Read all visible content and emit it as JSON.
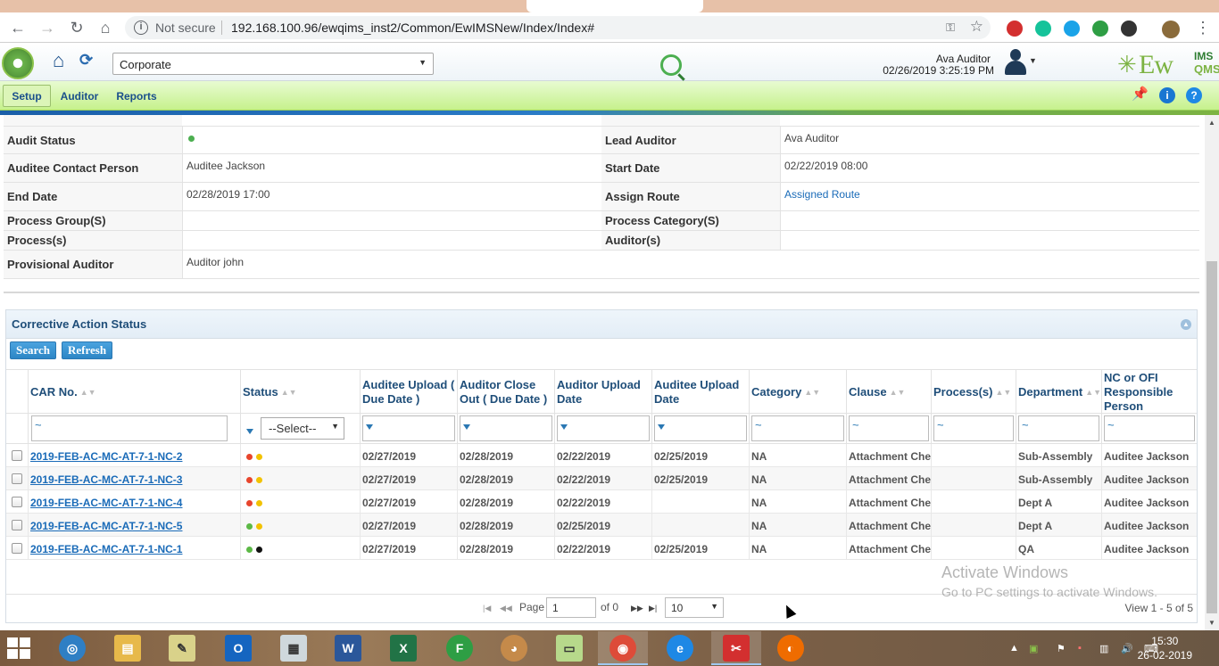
{
  "browser": {
    "security_label": "Not secure",
    "url": "192.168.100.96/ewqims_inst2/Common/EwIMSNew/Index/Index#"
  },
  "header": {
    "org_select_value": "Corporate",
    "user_name": "Ava Auditor",
    "user_datetime": "02/26/2019 3:25:19 PM",
    "brand_ew": "Ew",
    "brand_ims": "IMS",
    "brand_qms": "QMS"
  },
  "menu": {
    "items": [
      {
        "label": "Setup"
      },
      {
        "label": "Auditor"
      },
      {
        "label": "Reports"
      }
    ]
  },
  "details": {
    "audit_status": {
      "label": "Audit Status",
      "value": ""
    },
    "lead_auditor": {
      "label": "Lead Auditor",
      "value": "Ava Auditor"
    },
    "auditee_contact": {
      "label": "Auditee Contact Person",
      "value": "Auditee Jackson"
    },
    "start_date": {
      "label": "Start Date",
      "value": "02/22/2019 08:00"
    },
    "end_date": {
      "label": "End Date",
      "value": "02/28/2019 17:00"
    },
    "assign_route": {
      "label": "Assign Route",
      "value": "Assigned Route"
    },
    "process_group": {
      "label": "Process Group(S)",
      "value": ""
    },
    "process_category": {
      "label": "Process Category(S)",
      "value": ""
    },
    "processes": {
      "label": "Process(s)",
      "value": ""
    },
    "auditors": {
      "label": "Auditor(s)",
      "value": ""
    },
    "provisional_auditor": {
      "label": "Provisional Auditor",
      "value": "Auditor john"
    }
  },
  "car_panel": {
    "title": "Corrective Action Status",
    "search_label": "Search",
    "refresh_label": "Refresh",
    "columns": [
      {
        "label": "CAR No."
      },
      {
        "label": "Status"
      },
      {
        "label": "Auditee Upload ( Due Date )"
      },
      {
        "label": "Auditor Close Out ( Due Date )"
      },
      {
        "label": "Auditor Upload Date"
      },
      {
        "label": "Auditee Upload Date"
      },
      {
        "label": "Category"
      },
      {
        "label": "Clause"
      },
      {
        "label": "Process(s)"
      },
      {
        "label": "Department"
      },
      {
        "label": "NC or OFI Responsible Person"
      }
    ],
    "filter_placeholder": "~",
    "status_filter_value": "--Select--",
    "rows": [
      {
        "car_no": "2019-FEB-AC-MC-AT-7-1-NC-2",
        "dot1": "#e8452c",
        "dot2": "#f2c200",
        "auditee_due": "02/27/2019",
        "auditor_due": "02/28/2019",
        "auditor_upload": "02/22/2019",
        "auditee_upload": "02/25/2019",
        "category": "NA",
        "clause": "Attachment Chec",
        "process": "",
        "department": "Sub-Assembly",
        "responsible": "Auditee Jackson"
      },
      {
        "car_no": "2019-FEB-AC-MC-AT-7-1-NC-3",
        "dot1": "#e8452c",
        "dot2": "#f2c200",
        "auditee_due": "02/27/2019",
        "auditor_due": "02/28/2019",
        "auditor_upload": "02/22/2019",
        "auditee_upload": "02/25/2019",
        "category": "NA",
        "clause": "Attachment Chec",
        "process": "",
        "department": "Sub-Assembly",
        "responsible": "Auditee Jackson"
      },
      {
        "car_no": "2019-FEB-AC-MC-AT-7-1-NC-4",
        "dot1": "#e8452c",
        "dot2": "#f2c200",
        "auditee_due": "02/27/2019",
        "auditor_due": "02/28/2019",
        "auditor_upload": "02/22/2019",
        "auditee_upload": "",
        "category": "NA",
        "clause": "Attachment Chec",
        "process": "",
        "department": "Dept A",
        "responsible": "Auditee Jackson"
      },
      {
        "car_no": "2019-FEB-AC-MC-AT-7-1-NC-5",
        "dot1": "#5cb946",
        "dot2": "#f2c200",
        "auditee_due": "02/27/2019",
        "auditor_due": "02/28/2019",
        "auditor_upload": "02/25/2019",
        "auditee_upload": "",
        "category": "NA",
        "clause": "Attachment Chec",
        "process": "",
        "department": "Dept A",
        "responsible": "Auditee Jackson"
      },
      {
        "car_no": "2019-FEB-AC-MC-AT-7-1-NC-1",
        "dot1": "#5cb946",
        "dot2": "#111111",
        "auditee_due": "02/27/2019",
        "auditor_due": "02/28/2019",
        "auditor_upload": "02/22/2019",
        "auditee_upload": "02/25/2019",
        "category": "NA",
        "clause": "Attachment Chec",
        "process": "",
        "department": "QA",
        "responsible": "Auditee Jackson"
      }
    ],
    "pager": {
      "page_label": "Page",
      "page_value": "1",
      "of_label": "of 0",
      "page_size": "10",
      "view_label": "View 1 - 5 of 5"
    }
  },
  "watermark": {
    "line1": "Activate Windows",
    "line2": "Go to PC settings to activate Windows."
  },
  "taskbar": {
    "time": "15:30",
    "date": "26-02-2019"
  }
}
